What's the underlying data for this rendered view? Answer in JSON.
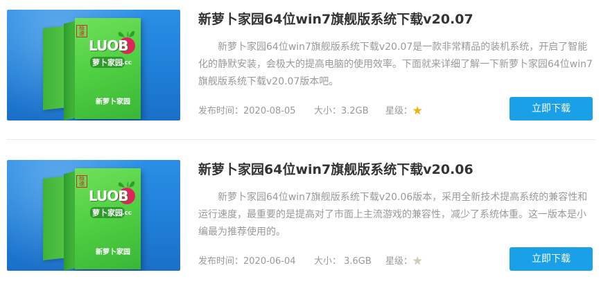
{
  "items": [
    {
      "title": "新萝卜家园64位win7旗舰版系统下载v20.07",
      "description": "新萝卜家园64位win7旗舰版系统下载v20.07是一款非常精品的装机系统，开启了智能化的静默安装，会极大的提高电脑的使用效率。下面就来详细了解一下新萝卜家园64位win7旗舰版系统下载v20.07版本吧。",
      "date_label": "发布时间：2020-08-05",
      "size_label": "大小：3.2GB",
      "rating_label": "星级：",
      "rating": 5,
      "download_label": "立即下载",
      "cover": {
        "logo": "LUOB",
        "logo_cn": "萝卜家园",
        "logo_suffix": ".cc",
        "brand": "新萝卜家园",
        "stamp": "极速"
      }
    },
    {
      "title": "新萝卜家园64位win7旗舰版系统下载v20.06",
      "description": "新萝卜家园64位win7旗舰版系统下载v20.06版本，采用全新技术提高系统的兼容性和运行速度，最重要的是提高对了市面上主流游戏的兼容性，减少了系统体重。这一版本是小编最为推荐使用的。",
      "date_label": "发布时间：2020-06-04",
      "size_label": "大小： 3.6GB",
      "rating_label": "星级：",
      "rating": 4,
      "download_label": "立即下载",
      "cover": {
        "logo": "LUOB",
        "logo_cn": "萝卜家园",
        "logo_suffix": ".cc",
        "brand": "新萝卜家园",
        "stamp": "极速"
      }
    }
  ],
  "colors": {
    "accent": "#1aa0e6",
    "star_on": "#f3b214",
    "star_off": "#cccccc"
  },
  "icons": {
    "star": "star-icon"
  }
}
